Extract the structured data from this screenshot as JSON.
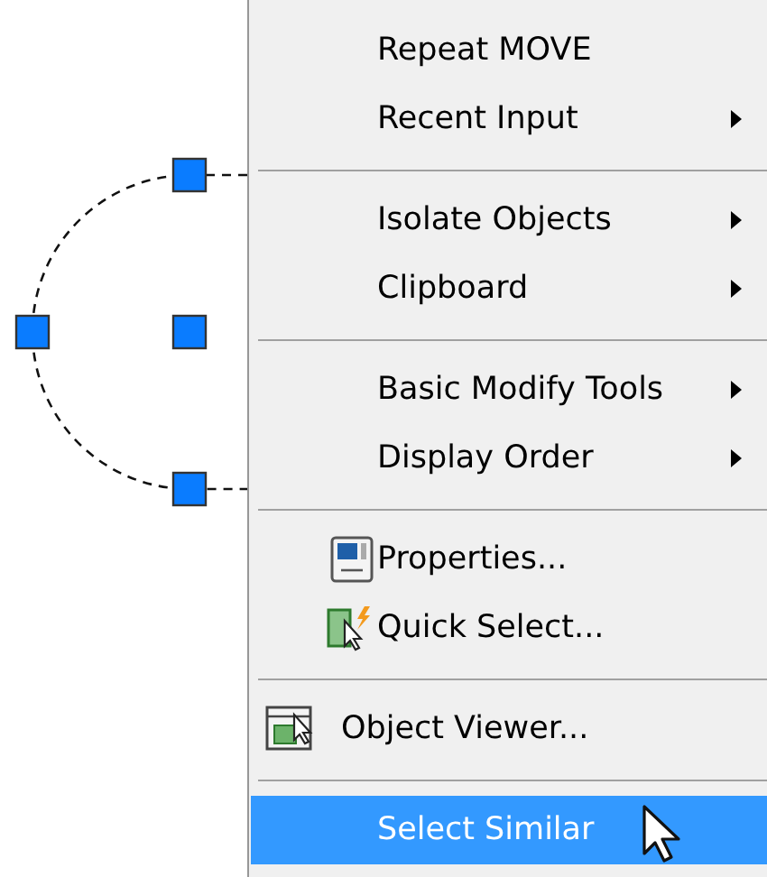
{
  "menu": {
    "groups": [
      [
        {
          "label": "Repeat MOVE",
          "kind": "plain",
          "submenu": false,
          "selected": false
        },
        {
          "label": "Recent Input",
          "kind": "plain",
          "submenu": true,
          "selected": false
        }
      ],
      [
        {
          "label": "Isolate Objects",
          "kind": "plain",
          "submenu": true,
          "selected": false
        },
        {
          "label": "Clipboard",
          "kind": "plain",
          "submenu": true,
          "selected": false
        }
      ],
      [
        {
          "label": "Basic Modify Tools",
          "kind": "plain",
          "submenu": true,
          "selected": false
        },
        {
          "label": "Display Order",
          "kind": "plain",
          "submenu": true,
          "selected": false
        }
      ],
      [
        {
          "label": "Properties...",
          "kind": "properties",
          "submenu": false,
          "selected": false
        },
        {
          "label": "Quick Select...",
          "kind": "quick-select",
          "submenu": false,
          "selected": false
        }
      ],
      [
        {
          "label": "Object Viewer...",
          "kind": "object-viewer",
          "submenu": false,
          "selected": false
        }
      ],
      [
        {
          "label": "Select Similar",
          "kind": "plain",
          "submenu": false,
          "selected": true
        }
      ]
    ]
  }
}
